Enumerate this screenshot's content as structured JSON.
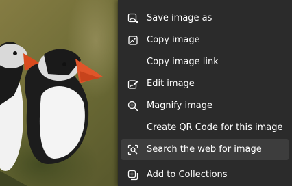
{
  "menu": {
    "items": [
      {
        "label": "Save image as",
        "icon": "save-image-icon"
      },
      {
        "label": "Copy image",
        "icon": "copy-image-icon"
      },
      {
        "label": "Copy image link",
        "icon": ""
      },
      {
        "label": "Edit image",
        "icon": "edit-image-icon"
      },
      {
        "label": "Magnify image",
        "icon": "magnify-icon"
      },
      {
        "label": "Create QR Code for this image",
        "icon": ""
      },
      {
        "label": "Search the web for image",
        "icon": "visual-search-icon"
      },
      {
        "label": "Add to Collections",
        "icon": "collections-icon"
      }
    ]
  }
}
